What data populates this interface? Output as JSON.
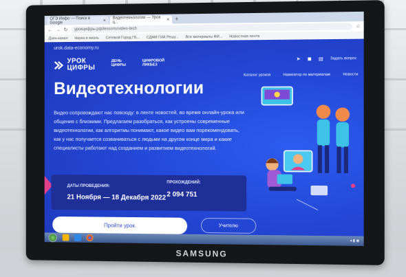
{
  "browser": {
    "tabs": [
      {
        "label": "ОГЭ Инфо — Поиск в Google",
        "active": false
      },
      {
        "label": "Видеотехнологии — Урок ц...",
        "active": true
      }
    ],
    "url": "урокцифры.рф/lessons/video-tech",
    "bookmarks": [
      "Дзен-канал",
      "Наука и жизнь",
      "Сетевой Город ГБ...",
      "СДАМ ГИА Решу...",
      "Все материалы ФИ...",
      "Новостная лента"
    ]
  },
  "site": {
    "site_url": "urok.data-economy.ru",
    "logo": "УРОК ЦИФРЫ",
    "nav": [
      "ДЕНЬ ЦИФРЫ",
      "ЦИФРОВОЙ ЛИКБЕЗ"
    ],
    "top_right": {
      "link": "Задать вопрос"
    },
    "submenu": [
      "Каталог уроков",
      "Навигатор по материалам",
      "Новости"
    ]
  },
  "hero": {
    "title": "Видеотехнологии",
    "description": "Видео сопровождают нас повсюду: в ленте новостей, во время онлайн-урока или общения с близкими. Предлагаем разобраться, как устроены современные видеотехнологии, как алгоритмы понимают, какое видео вам порекомендовать, как у нас получается созваниваться с людьми на другом конце мира и какие специалисты работают над созданием и развитием видеотехнологий.",
    "dates_label": "ДАТЫ ПРОВЕДЕНИЯ:",
    "dates_value": "21 Ноября — 18 Декабря 2022",
    "passes_label": "ПРОХОЖДЕНИЙ:",
    "passes_value": "2 094 751",
    "start_button": "Пройти урок",
    "teacher_button": "Учителю"
  },
  "monitor": {
    "brand": "SAMSUNG"
  },
  "colors": {
    "page_bg": "#2142c8",
    "accent_pink": "#e0418a",
    "info_box": "#1f2f98"
  }
}
